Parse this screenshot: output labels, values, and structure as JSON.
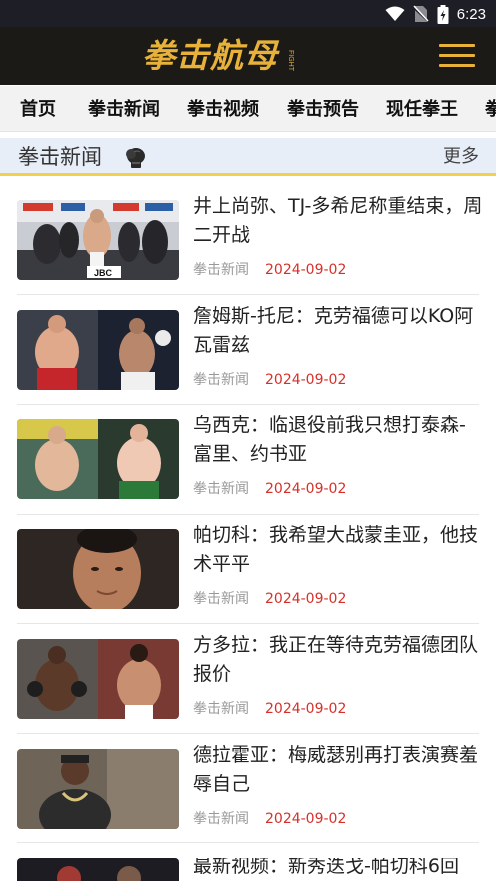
{
  "status_bar": {
    "time": "6:23",
    "icons": [
      "wifi-icon",
      "no-sim-icon",
      "battery-icon"
    ],
    "background": "#1e1e26"
  },
  "header": {
    "logo_text": "拳击航母",
    "logo_sub": [
      "FIGHT",
      "BOXING"
    ],
    "background": "#1b1a17",
    "accent": "#e8b23a"
  },
  "nav": {
    "tabs": [
      {
        "label": "首页"
      },
      {
        "label": "拳击新闻"
      },
      {
        "label": "拳击视频"
      },
      {
        "label": "拳击预告"
      },
      {
        "label": "现任拳王"
      },
      {
        "label": "拳"
      }
    ]
  },
  "section": {
    "title": "拳击新闻",
    "more": "更多",
    "icon": "boxing-glove-icon"
  },
  "news": [
    {
      "title": "井上尚弥、TJ-多希尼称重结束，周二开战",
      "category": "拳击新闻",
      "date": "2024-09-02"
    },
    {
      "title": "詹姆斯-托尼：克劳福德可以KO阿瓦雷兹",
      "category": "拳击新闻",
      "date": "2024-09-02"
    },
    {
      "title": "乌西克：临退役前我只想打泰森-富里、约书亚",
      "category": "拳击新闻",
      "date": "2024-09-02"
    },
    {
      "title": "帕切科：我希望大战蒙圭亚，他技术平平",
      "category": "拳击新闻",
      "date": "2024-09-02"
    },
    {
      "title": "方多拉：我正在等待克劳福德团队报价",
      "category": "拳击新闻",
      "date": "2024-09-02"
    },
    {
      "title": "德拉霍亚：梅威瑟别再打表演赛羞辱自己",
      "category": "拳击新闻",
      "date": "2024-09-02"
    },
    {
      "title": "最新视频：新秀迭戈-帕切科6回",
      "category": "",
      "date": ""
    }
  ],
  "colors": {
    "date": "#d7302a",
    "section_bg": "#e8eef8",
    "section_underline": "#f3cf4a"
  }
}
